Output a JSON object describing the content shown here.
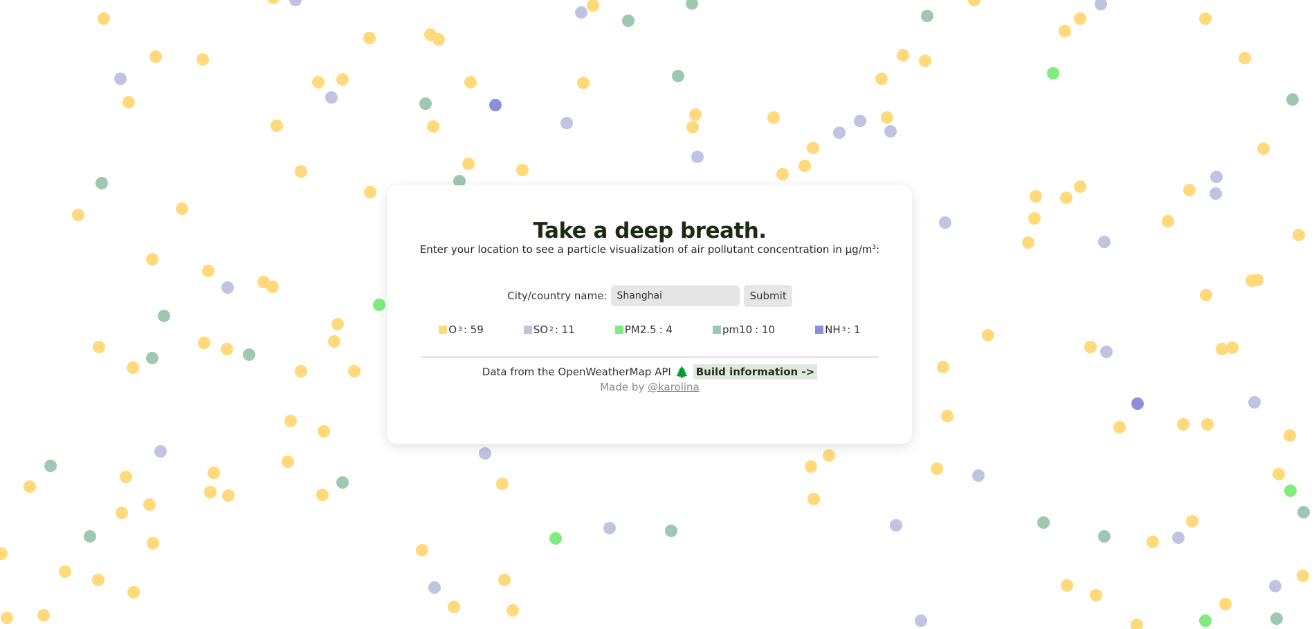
{
  "title": "Take a deep breath.",
  "subtitle": {
    "prefix": "Enter your location to see a particle visualization of air pollutant concentration in μg/m",
    "superscript": "3",
    "suffix": ":"
  },
  "form": {
    "label": "City/country name:",
    "input_value": "Shanghai",
    "submit_label": "Submit"
  },
  "legend": [
    {
      "base": "O",
      "sup": "3",
      "value": ": 59",
      "color": "#ffd97a"
    },
    {
      "base": "SO",
      "sup": "2",
      "value": ": 11",
      "color": "#bec4e1"
    },
    {
      "base": "PM2.5",
      "sup": "",
      "value": ": 4",
      "color": "#7eec7e"
    },
    {
      "base": "pm10",
      "sup": "",
      "value": ": 10",
      "color": "#9ec8b0"
    },
    {
      "base": "NH",
      "sup": "3",
      "value": ": 1",
      "color": "#8d8fdc"
    }
  ],
  "footer": {
    "data_source": "Data from the OpenWeatherMap API",
    "tree_icon": "🌲",
    "build_link": "Build information ->",
    "made_by_prefix": "Made by",
    "made_by_link": "@karolina"
  },
  "colors": {
    "o3": "#ffd97a",
    "so2": "#bec4e1",
    "pm25": "#7eec7e",
    "pm10": "#9ec8b0",
    "nh3": "#8d8fdc"
  }
}
